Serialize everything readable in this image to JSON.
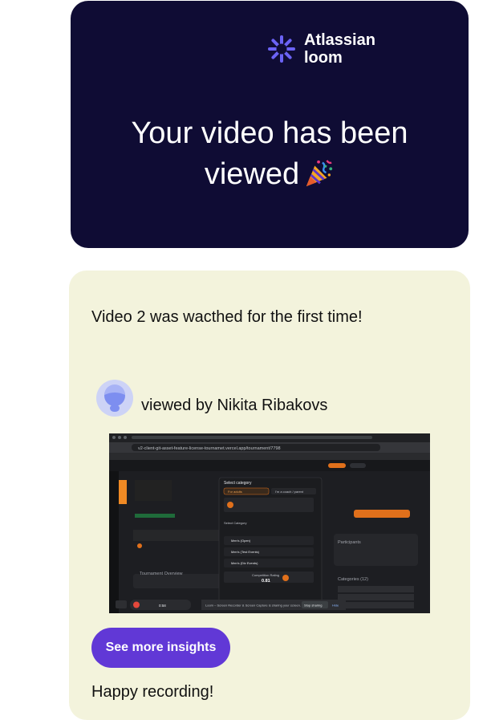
{
  "brand": {
    "line1": "Atlassian",
    "line2": "loom",
    "icon": "loom-logo-icon"
  },
  "hero": {
    "line1": "Your video has been",
    "line2": "viewed",
    "emoji_icon": "party-popper-icon"
  },
  "card": {
    "message": "Video 2 was wacthed for the first time!",
    "viewer_text": "viewed by Nikita Ribakovs",
    "cta_label": "See more insights",
    "signoff": "Happy recording!"
  },
  "thumbnail": {
    "url": "v2-client-git-asset-feature-license-tournamet.vercel.app/tournament/7798",
    "modal_title": "Select category",
    "tab_left": "For adults",
    "tab_right": "I'm a coach / parent",
    "section_label": "Select Category",
    "categories": [
      "Men's (Open)",
      "Men's (Test Events)",
      "Men's (Div Events)"
    ],
    "competition_rating_label": "Competition Rating",
    "competition_rating_value": "0.81",
    "time_label": "0:58",
    "share_banner": "Loom – Screen Recorder & Screen Capture is sharing your screen.",
    "stop_sharing": "Stop sharing",
    "hide": "Hide",
    "participants_label": "Participants",
    "tournament_overview": "Tournament Overview",
    "categories_label": "Categories (12)"
  },
  "colors": {
    "hero_bg": "#0f0c34",
    "card_bg": "#f3f3dc",
    "accent": "#6138d6",
    "brand_icon": "#6b63f5"
  }
}
